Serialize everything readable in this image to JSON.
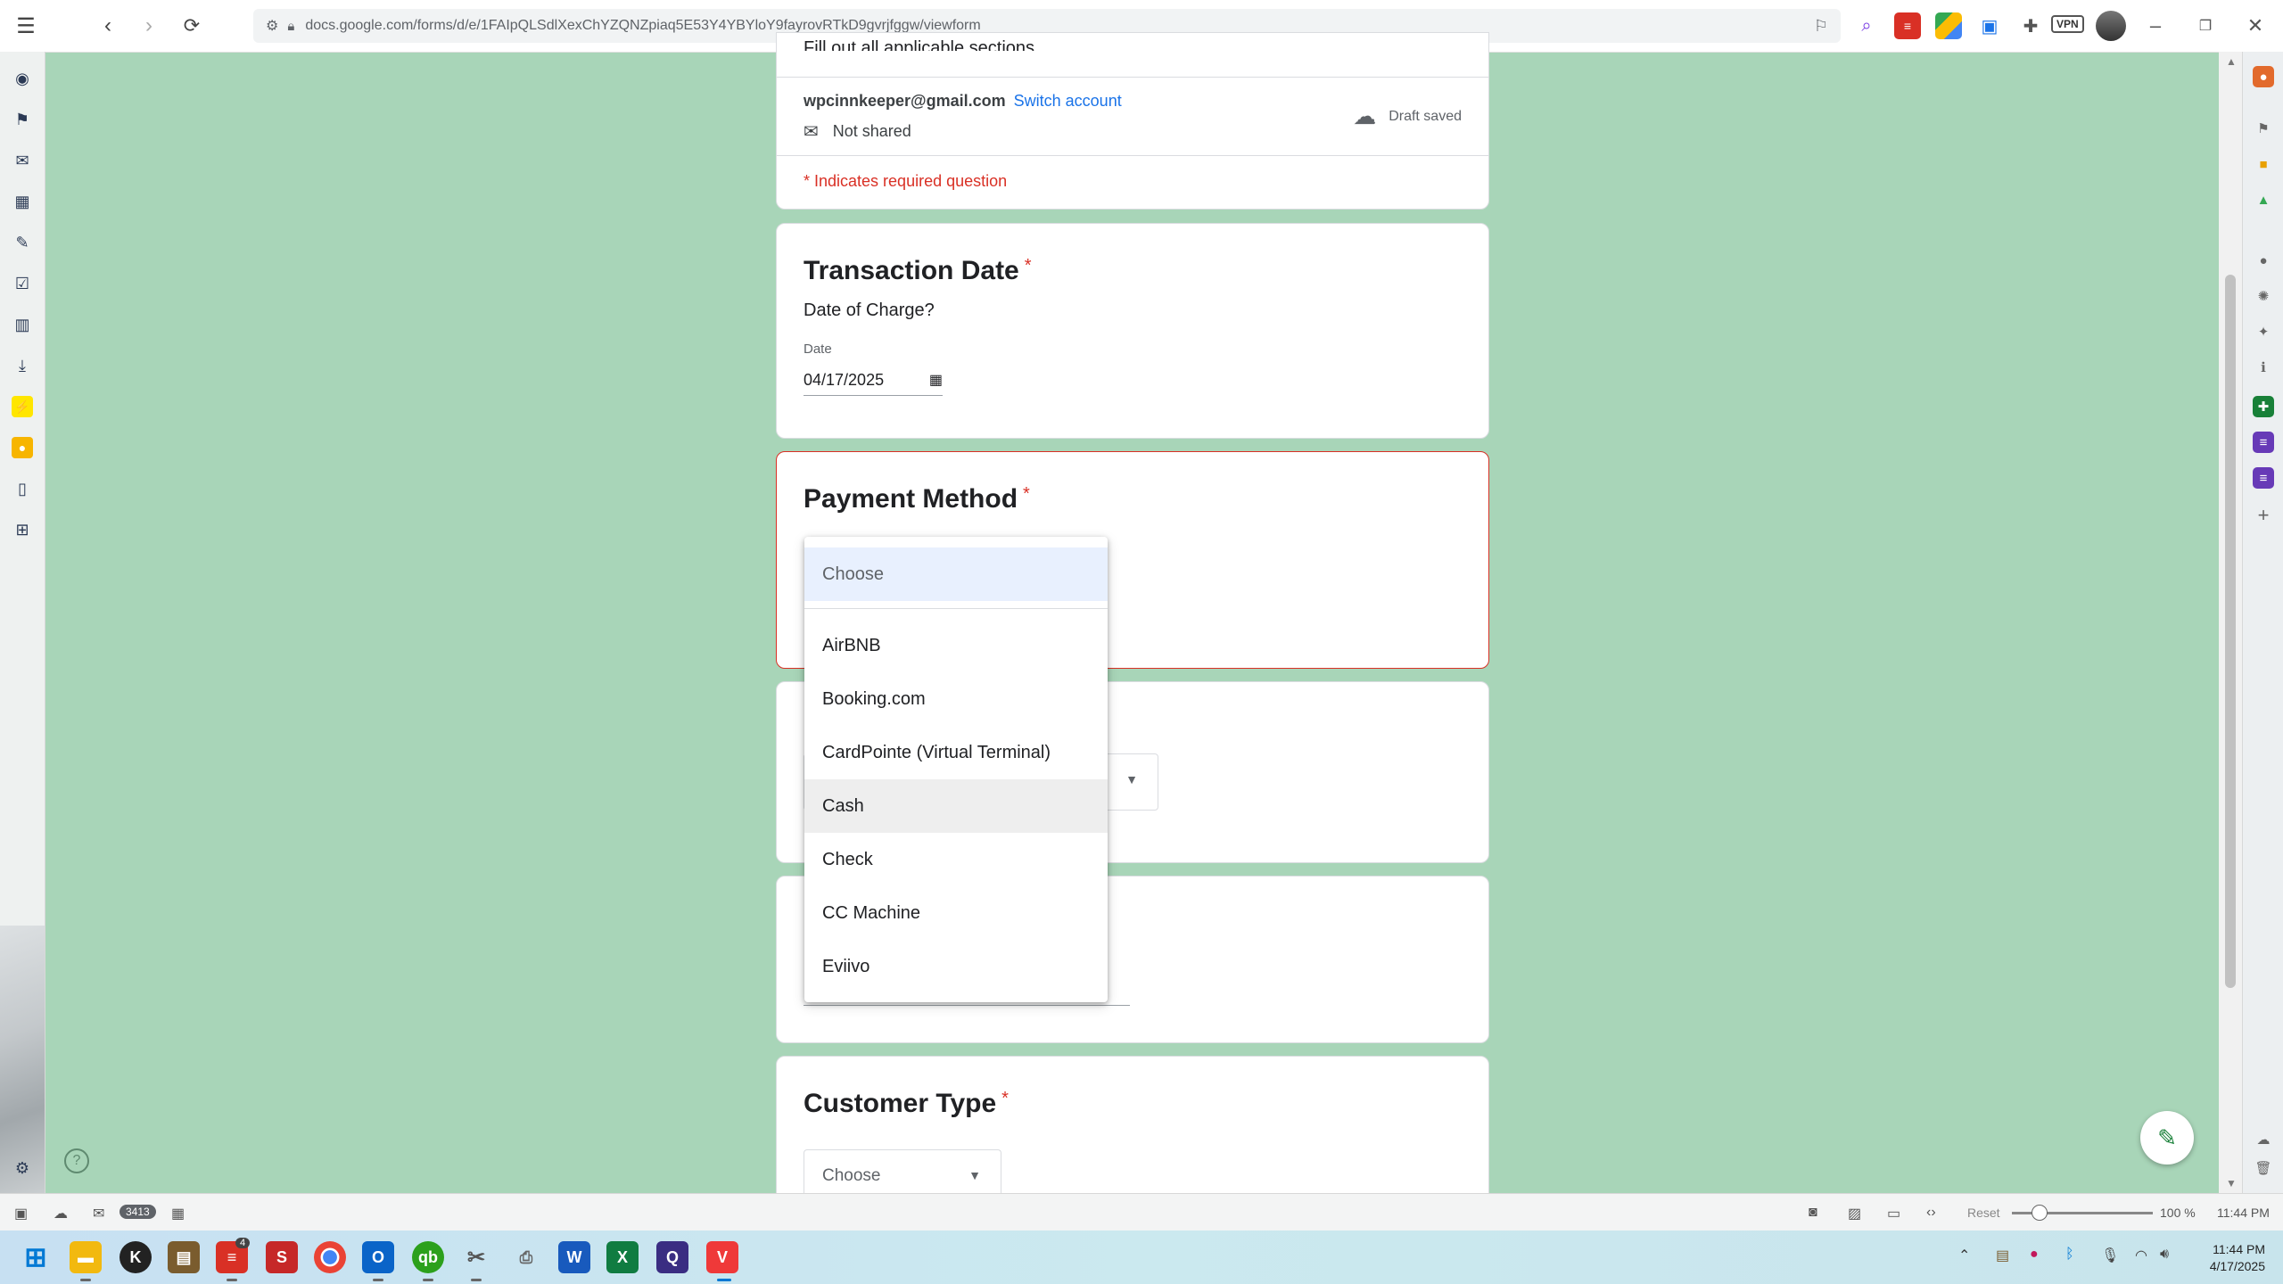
{
  "browser": {
    "url": "docs.google.com/forms/d/e/1FAIpQLSdlXexChYZQNZpiaq5E53Y4YBYloY9fayrovRTkD9gvrjfggw/viewform",
    "vpn_label": "VPN"
  },
  "form_header": {
    "truncated_text": "Fill out all applicable sections.",
    "email": "wpcinnkeeper@gmail.com",
    "switch_account": "Switch account",
    "not_shared": "Not shared",
    "draft_saved": "Draft saved",
    "required_note": "* Indicates required question"
  },
  "transaction_date": {
    "title": "Transaction Date",
    "required_mark": "*",
    "description": "Date of Charge?",
    "field_label": "Date",
    "value": "04/17/2025"
  },
  "payment_method": {
    "title": "Payment Method",
    "required_mark": "*"
  },
  "dropdown": {
    "placeholder": "Choose",
    "options": [
      "AirBNB",
      "Booking.com",
      "CardPointe (Virtual Terminal)",
      "Cash",
      "Check",
      "CC Machine",
      "Eviivo"
    ],
    "highlighted": "Cash"
  },
  "customer_type": {
    "title": "Customer Type",
    "required_mark": "*",
    "select_value": "Choose"
  },
  "statusbar": {
    "badge_count": "3413",
    "reset_label": "Reset",
    "zoom": "100 %",
    "time": "11:44 PM"
  },
  "taskbar": {
    "time": "11:44 PM",
    "date": "4/17/2025",
    "notification_badge": "4"
  },
  "colors": {
    "page_bg": "#a8d5b8",
    "link": "#1a73e8",
    "required": "#d93025",
    "error_border": "#d93025"
  }
}
